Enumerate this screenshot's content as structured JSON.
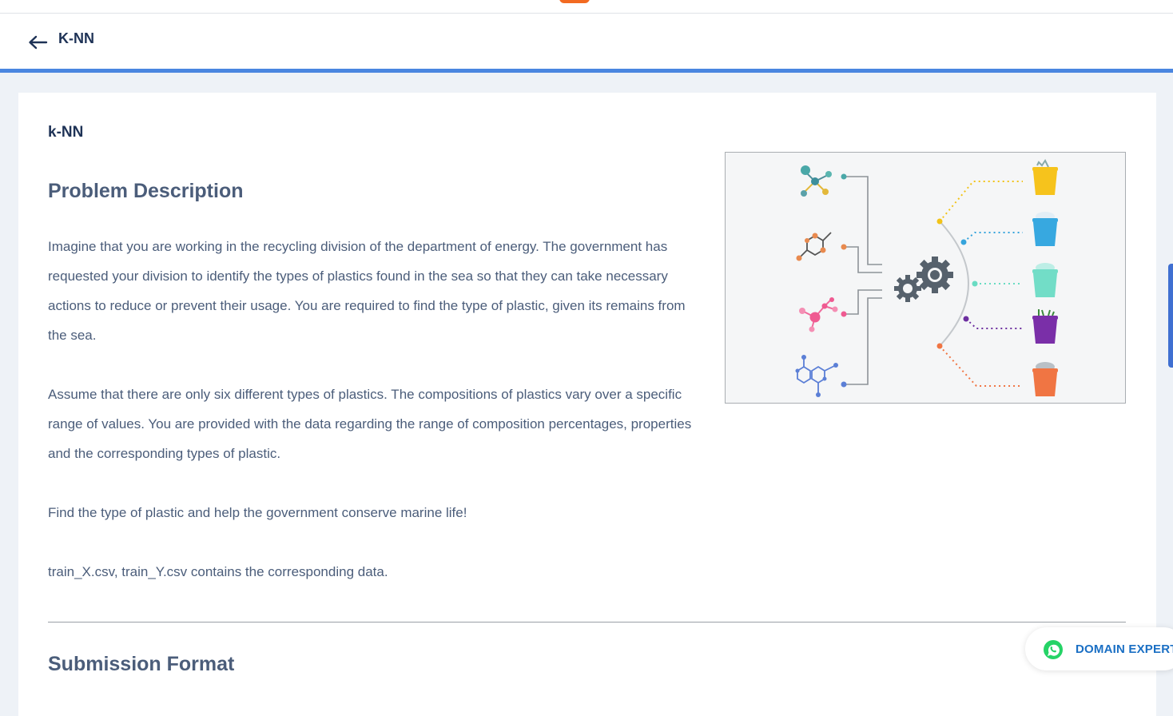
{
  "header": {
    "title": "K-NN"
  },
  "content": {
    "section_label": "k-NN",
    "problem_heading": "Problem Description",
    "paragraphs": [
      "Imagine that you are working in the recycling division of the department of energy. The government has requested your division to identify the types of plastics found in the sea so that they can take necessary actions to reduce or prevent their usage. You are required to find the type of plastic, given its remains from the sea.",
      "Assume that there are only six different types of plastics. The compositions of plastics vary over a specific range of values. You are provided with the data regarding the range of composition percentages, properties and the corresponding types of plastic.",
      "Find the type of plastic and help the government conserve marine life!",
      "train_X.csv, train_Y.csv contains the corresponding data."
    ],
    "submission_heading": "Submission Format"
  },
  "floating": {
    "expert_label": "DOMAIN EXPERT"
  },
  "colors": {
    "accent_bar": "#4a86e0",
    "heading": "#4b5d7a",
    "title": "#1e3256",
    "expert": "#1a6fc4",
    "whatsapp": "#25d366"
  }
}
